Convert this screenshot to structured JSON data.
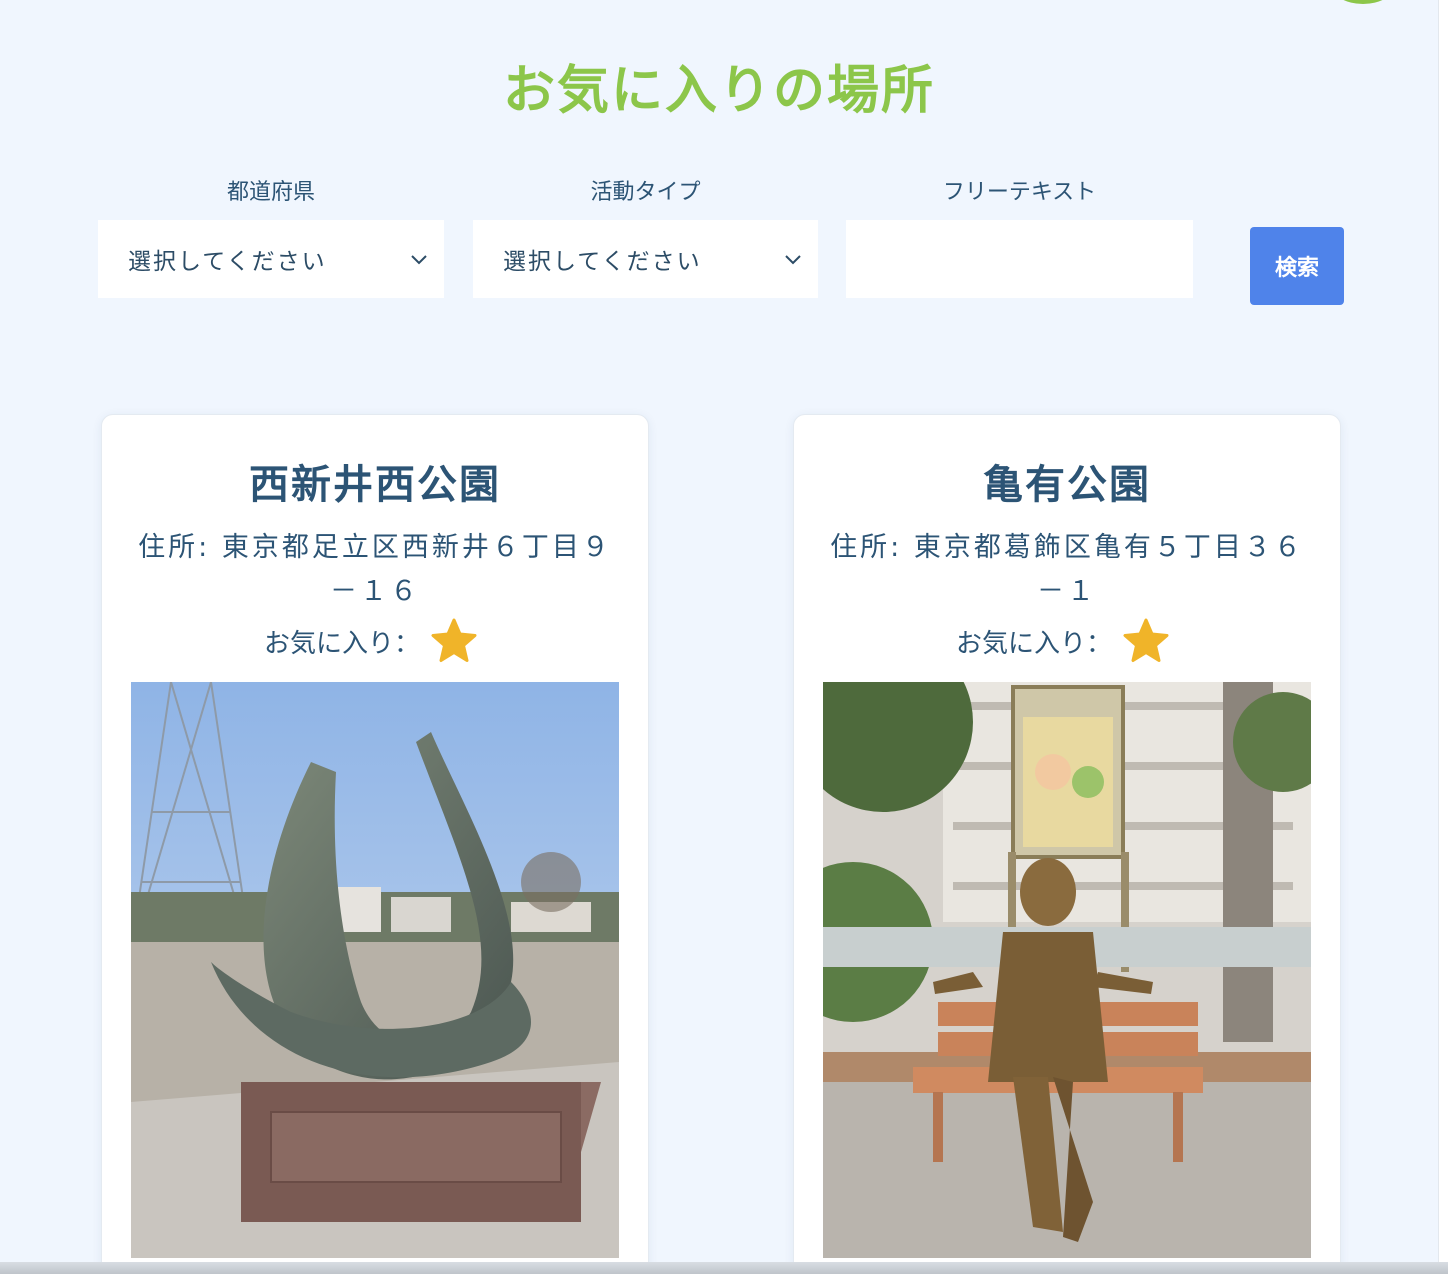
{
  "page": {
    "title": "お気に入りの場所"
  },
  "filters": {
    "prefecture": {
      "label": "都道府県",
      "value": "選択してください"
    },
    "activity": {
      "label": "活動タイプ",
      "value": "選択してください"
    },
    "free_text": {
      "label": "フリーテキスト",
      "value": "",
      "placeholder": ""
    },
    "search_label": "検索"
  },
  "cards": [
    {
      "name": "西新井西公園",
      "address_line1": "住所: 東京都足立区西新井６丁目９",
      "address_line2": "－１６",
      "favorite_label": "お気に入り：",
      "favorite_icon": "star-icon",
      "photo": "sculpture photo"
    },
    {
      "name": "亀有公園",
      "address_line1": "住所: 東京都葛飾区亀有５丁目３６",
      "address_line2": "－１",
      "favorite_label": "お気に入り：",
      "favorite_icon": "star-icon",
      "photo": "bench statue photo"
    }
  ],
  "colors": {
    "title": "#8cc64a",
    "text": "#2c5475",
    "button": "#4f83ea",
    "star": "#f0b429",
    "background": "#f0f6fe"
  }
}
